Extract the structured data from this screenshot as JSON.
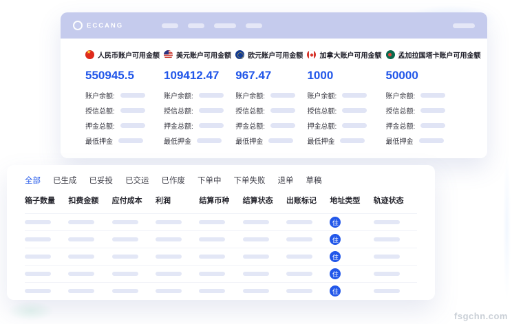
{
  "watermark": "fsgchn.com",
  "header": {
    "logo_text": "ECCANG"
  },
  "colors": {
    "accent_blue": "#2257e9",
    "header_bg": "#c5cbed",
    "placeholder": "#e0e4f5"
  },
  "accounts": {
    "row_labels": [
      "账户余额:",
      "授信总额:",
      "押金总额:",
      "最低押金"
    ],
    "items": [
      {
        "flag": "cn",
        "flag_name": "china-flag-icon",
        "title": "人民币账户可用金额",
        "amount": "550945.5"
      },
      {
        "flag": "us",
        "flag_name": "usa-flag-icon",
        "title": "美元账户可用金额",
        "amount": "109412.47"
      },
      {
        "flag": "eu",
        "flag_name": "eu-flag-icon",
        "title": "欧元账户可用金额",
        "amount": "967.47"
      },
      {
        "flag": "ca",
        "flag_name": "canada-flag-icon",
        "title": "加拿大账户可用金额",
        "amount": "1000"
      },
      {
        "flag": "bd",
        "flag_name": "bangladesh-flag-icon",
        "title": "孟加拉国塔卡账户可用金额",
        "amount": "50000"
      }
    ]
  },
  "orders": {
    "tabs": [
      {
        "label": "全部",
        "active": true
      },
      {
        "label": "已生成",
        "active": false
      },
      {
        "label": "已妥投",
        "active": false
      },
      {
        "label": "已交运",
        "active": false
      },
      {
        "label": "已作废",
        "active": false
      },
      {
        "label": "下单中",
        "active": false
      },
      {
        "label": "下单失败",
        "active": false
      },
      {
        "label": "退单",
        "active": false
      },
      {
        "label": "草稿",
        "active": false
      }
    ],
    "columns": [
      "箱子数量",
      "扣费金额",
      "应付成本",
      "利润",
      "结算币种",
      "结算状态",
      "出账标记",
      "地址类型",
      "轨迹状态"
    ],
    "address_badge": "住",
    "badge_column": 7,
    "row_count": 5
  }
}
